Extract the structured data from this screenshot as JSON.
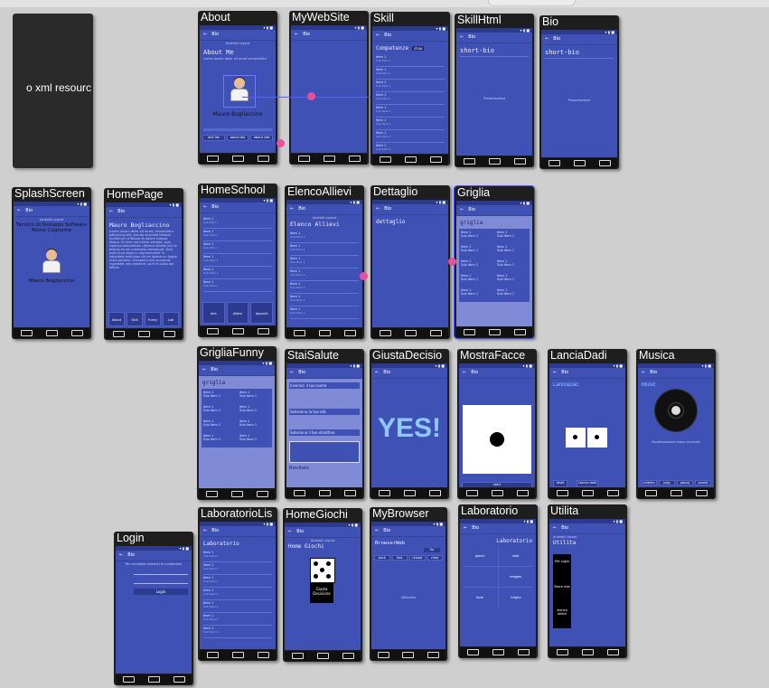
{
  "placeholder_text": "o xml resourc",
  "phones": {
    "about": {
      "title": "About",
      "appbar": "Bio",
      "heading": "About Me",
      "name": "Mauro Bogliaccino",
      "buttons": [
        "skill list",
        "about bio",
        "about site"
      ]
    },
    "mywebsite": {
      "title": "MyWebSite",
      "appbar": "Bio"
    },
    "skill": {
      "title": "Skill",
      "appbar": "Bio",
      "heading": "Competenze",
      "chip": "show"
    },
    "skillhtml": {
      "title": "SkillHtml",
      "appbar": "Bio",
      "heading": "short-bio",
      "body": "Presentazione"
    },
    "bio": {
      "title": "Bio",
      "appbar": "Bio",
      "heading": "short-bio",
      "body": "Presentazione"
    },
    "splash": {
      "title": "SplashScreen",
      "appbar": "Bio",
      "line1": "Tecnico di Sviluppo Software",
      "line2": "Nome Cognome",
      "name": "Mauro Bogliaccino"
    },
    "homepage": {
      "title": "HomePage",
      "appbar": "Bio",
      "heading": "Mauro Bogliaccino",
      "buttons": [
        "About",
        "Skill",
        "Funny",
        "Lab"
      ]
    },
    "homeschool": {
      "title": "HomeSchool",
      "appbar": "Bio",
      "buttons": [
        "Info",
        "Allievi",
        "Appunti"
      ]
    },
    "elencoallievi": {
      "title": "ElencoAllievi",
      "appbar": "Bio",
      "heading": "Elenco Allievi"
    },
    "dettaglio": {
      "title": "Dettaglio",
      "appbar": "Bio",
      "heading": "dettaglio"
    },
    "griglia": {
      "title": "Griglia",
      "appbar": "Bio",
      "heading": "griglia"
    },
    "grigliafunny": {
      "title": "GrigliaFunny",
      "appbar": "Bio",
      "heading": "griglia"
    },
    "staisalute": {
      "title": "StaiSalute",
      "appbar": "Bio",
      "field1": "Inserisci il tuo nome",
      "field2": "Seleziona la tua età",
      "field3": "Seleziona il tuo obiettivo",
      "result": "Risultato"
    },
    "giustadecisione": {
      "title": "GiustaDecisio",
      "appbar": "Bio",
      "answer": "YES!"
    },
    "mostrafacce": {
      "title": "MostraFacce",
      "appbar": "Bio",
      "button": "start"
    },
    "lanciadadi": {
      "title": "LanciaDadi",
      "appbar": "Bio",
      "heading": "LanciaDac",
      "buttons": [
        "reset",
        "Lancia dadi"
      ]
    },
    "musica": {
      "title": "Musica",
      "appbar": "Bio",
      "heading": "Music",
      "buttons": [
        "indietro",
        "play",
        "pausa",
        "avanti"
      ]
    },
    "login": {
      "title": "Login",
      "appbar": "Bio",
      "button": "Login"
    },
    "laboratoriolist": {
      "title": "LaboratorioLis",
      "appbar": "Bio",
      "heading": "Laboratorio"
    },
    "homegiochi": {
      "title": "HomeGiochi",
      "appbar": "Bio",
      "heading": "Home Giochi",
      "tile": "Giusta Decisione"
    },
    "mybrowser": {
      "title": "MyBrowser",
      "appbar": "Bio",
      "heading": "BrowserWeb",
      "buttons": [
        "back",
        "fwd",
        "reload",
        "clear"
      ],
      "go": "Go",
      "body": "Webview"
    },
    "laboratorio": {
      "title": "Laboratorio",
      "appbar": "Bio",
      "heading": "Laboratorio",
      "cells": [
        "giochi",
        "web",
        "",
        "Images",
        "form",
        "Griglia"
      ]
    },
    "utilita": {
      "title": "Utilita",
      "appbar": "Bio",
      "heading": "Utilita",
      "buttons": [
        "Pet Login",
        "Barre ride",
        "elenco allievi"
      ]
    }
  },
  "list_item": "Item 1",
  "list_sub": "Sub Item 1"
}
